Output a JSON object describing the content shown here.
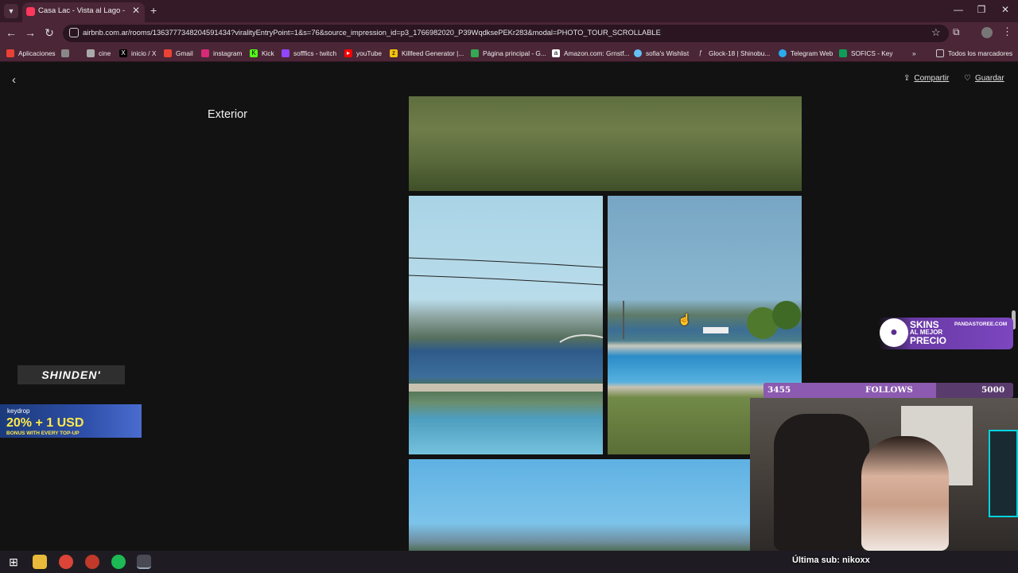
{
  "browser": {
    "tab_title": "Casa Lac - Vista al Lago - Casas",
    "tab_close": "✕",
    "new_tab": "+",
    "url": "airbnb.com.ar/rooms/1363777348204591434?viralityEntryPoint=1&s=76&source_impression_id=p3_1766982020_P39WqdksePEKr283&modal=PHOTO_TOUR_SCROLLABLE",
    "window_controls": [
      "—",
      "❐",
      "✕"
    ]
  },
  "bookmarks": [
    {
      "label": "Aplicaciones",
      "icon": "apps-grid-icon",
      "color": "#e94235"
    },
    {
      "label": "",
      "icon": "tab-groups-icon",
      "color": "#888888"
    },
    {
      "label": "cine",
      "icon": "folder-icon",
      "color": "#aaaaaa"
    },
    {
      "label": "inicio / X",
      "icon": "x-icon",
      "color": "#000000"
    },
    {
      "label": "Gmail",
      "icon": "gmail-icon",
      "color": "#ea4335"
    },
    {
      "label": "instagram",
      "icon": "instagram-icon",
      "color": "#d62976"
    },
    {
      "label": "Kick",
      "icon": "kick-icon",
      "color": "#53fc18"
    },
    {
      "label": "sofffics - twitch",
      "icon": "twitch-icon",
      "color": "#9146ff"
    },
    {
      "label": "youTube",
      "icon": "youtube-icon",
      "color": "#ff0000"
    },
    {
      "label": "Killfeed Generator |...",
      "icon": "killfeed-icon",
      "color": "#f4c20d"
    },
    {
      "label": "Página principal - G...",
      "icon": "drive-icon",
      "color": "#34a853"
    },
    {
      "label": "Amazon.com: Grnstf...",
      "icon": "amazon-icon",
      "color": "#ffffff"
    },
    {
      "label": "sofia's Wishlist",
      "icon": "steam-icon",
      "color": "#66c0f4"
    },
    {
      "label": "Glock-18 | Shinobu...",
      "icon": "glock-icon",
      "color": "#4b2636"
    },
    {
      "label": "Telegram Web",
      "icon": "telegram-icon",
      "color": "#2aabee"
    },
    {
      "label": "SOFICS - Key",
      "icon": "sheets-icon",
      "color": "#0f9d58"
    }
  ],
  "bookmarks_overflow": "»",
  "all_bookmarks": "Todos los marcadores",
  "page": {
    "back": "‹",
    "share_label": "Compartir",
    "save_label": "Guardar",
    "section_title": "Exterior"
  },
  "overlays": {
    "shinden": "SHINDEN'",
    "keydrop_name": "keydrop",
    "keydrop_promo": "20% + 1 USD",
    "keydrop_sub": "BONUS WITH EVERY TOP-UP",
    "panda_line1": "SKINS",
    "panda_line2": "AL MEJOR",
    "panda_line3": "PRECIO",
    "panda_site": "PANDASTOREE.COM",
    "follow_current": "3455",
    "follow_label": "FOLLOWS",
    "follow_goal": "5000",
    "follow_progress": 0.691,
    "last_sub": "Última sub: nikoxx"
  }
}
